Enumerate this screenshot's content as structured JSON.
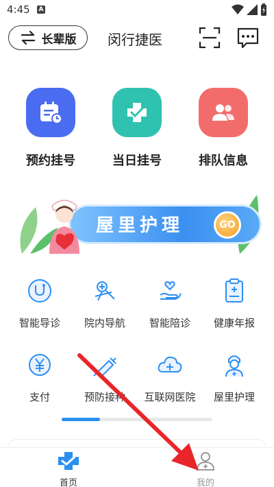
{
  "status_bar": {
    "time": "4:45",
    "notification_letter": "A"
  },
  "header": {
    "elder_mode_label": "长辈版",
    "app_title": "闵行捷医"
  },
  "quick_actions": [
    {
      "label": "预约挂号",
      "color": "#4a6cf0"
    },
    {
      "label": "当日挂号",
      "color": "#2fc2b0"
    },
    {
      "label": "排队信息",
      "color": "#f26c6c"
    }
  ],
  "banner": {
    "text": "屋里护理",
    "go_label": "GO"
  },
  "services": [
    {
      "label": "智能导诊",
      "icon": "stethoscope-chat-icon"
    },
    {
      "label": "院内导航",
      "icon": "navigation-map-icon"
    },
    {
      "label": "智能陪诊",
      "icon": "heart-hand-icon"
    },
    {
      "label": "健康年报",
      "icon": "clipboard-report-icon"
    },
    {
      "label": "支付",
      "icon": "yen-coin-icon"
    },
    {
      "label": "预防接种",
      "icon": "syringe-icon"
    },
    {
      "label": "互联网医院",
      "icon": "cloud-medical-icon"
    },
    {
      "label": "屋里护理",
      "icon": "nurse-icon"
    }
  ],
  "page_indicator": {
    "current_page": 1,
    "total_pages": 2
  },
  "tabbar": {
    "tabs": [
      {
        "label": "首页",
        "active": true,
        "color": "#2b8ff0"
      },
      {
        "label": "我的",
        "active": false,
        "color": "#999999"
      }
    ]
  },
  "colors": {
    "accent": "#2b8ff0",
    "annotation_arrow": "#e8262a"
  }
}
